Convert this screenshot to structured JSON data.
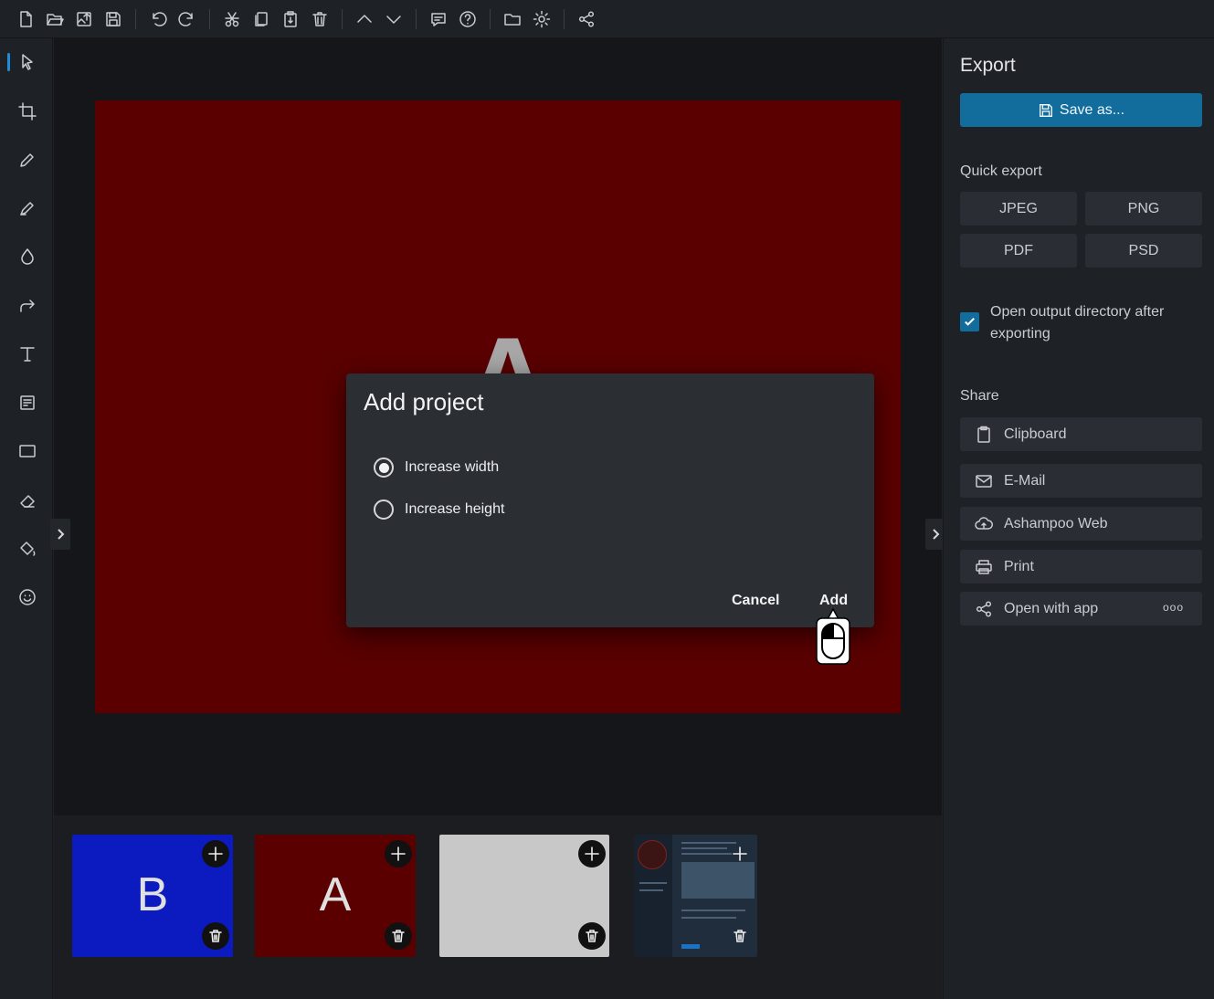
{
  "colors": {
    "accent": "#136d9c",
    "artboard": "#5a0000",
    "dialog_bg": "#2b2e33",
    "panel_bg": "#1e2126"
  },
  "toolbar": {
    "icons": [
      "new-file-icon",
      "open-folder-icon",
      "import-image-icon",
      "save-icon",
      "undo-icon",
      "redo-icon",
      "cut-icon",
      "copy-icon",
      "paste-icon",
      "delete-icon",
      "chevron-up-icon",
      "chevron-down-icon",
      "feedback-icon",
      "help-icon",
      "folder-icon",
      "settings-icon",
      "share-icon"
    ]
  },
  "tools": [
    "select-tool",
    "crop-tool",
    "pencil-tool",
    "marker-tool",
    "blur-tool",
    "arrow-tool",
    "text-tool",
    "note-tool",
    "rectangle-tool",
    "eraser-tool",
    "fill-tool",
    "emoji-tool"
  ],
  "canvas": {
    "letter": "A"
  },
  "dialog": {
    "title": "Add project",
    "options": [
      {
        "label": "Increase width",
        "checked": true
      },
      {
        "label": "Increase height",
        "checked": false
      }
    ],
    "cancel_label": "Cancel",
    "add_label": "Add"
  },
  "export_panel": {
    "title": "Export",
    "save_label": "Save as...",
    "quick_export_label": "Quick export",
    "quick_export": [
      "JPEG",
      "PNG",
      "PDF",
      "PSD"
    ],
    "open_dir_label": "Open output directory after exporting",
    "open_dir_checked": true,
    "share_label": "Share",
    "share": [
      {
        "label": "Clipboard",
        "icon": "clipboard-icon"
      },
      {
        "label": "E-Mail",
        "icon": "mail-icon"
      },
      {
        "label": "Ashampoo Web",
        "icon": "cloud-upload-icon"
      },
      {
        "label": "Print",
        "icon": "printer-icon"
      },
      {
        "label": "Open with app",
        "icon": "share-icon"
      }
    ],
    "more_label": "ooo"
  },
  "projects": [
    {
      "letter": "B",
      "bg": "#0c1bbf"
    },
    {
      "letter": "A",
      "bg": "#5a0000"
    },
    {
      "letter": "",
      "bg": "#c8c8c8"
    },
    {
      "letter": "",
      "bg": "#1f2d3d"
    }
  ]
}
